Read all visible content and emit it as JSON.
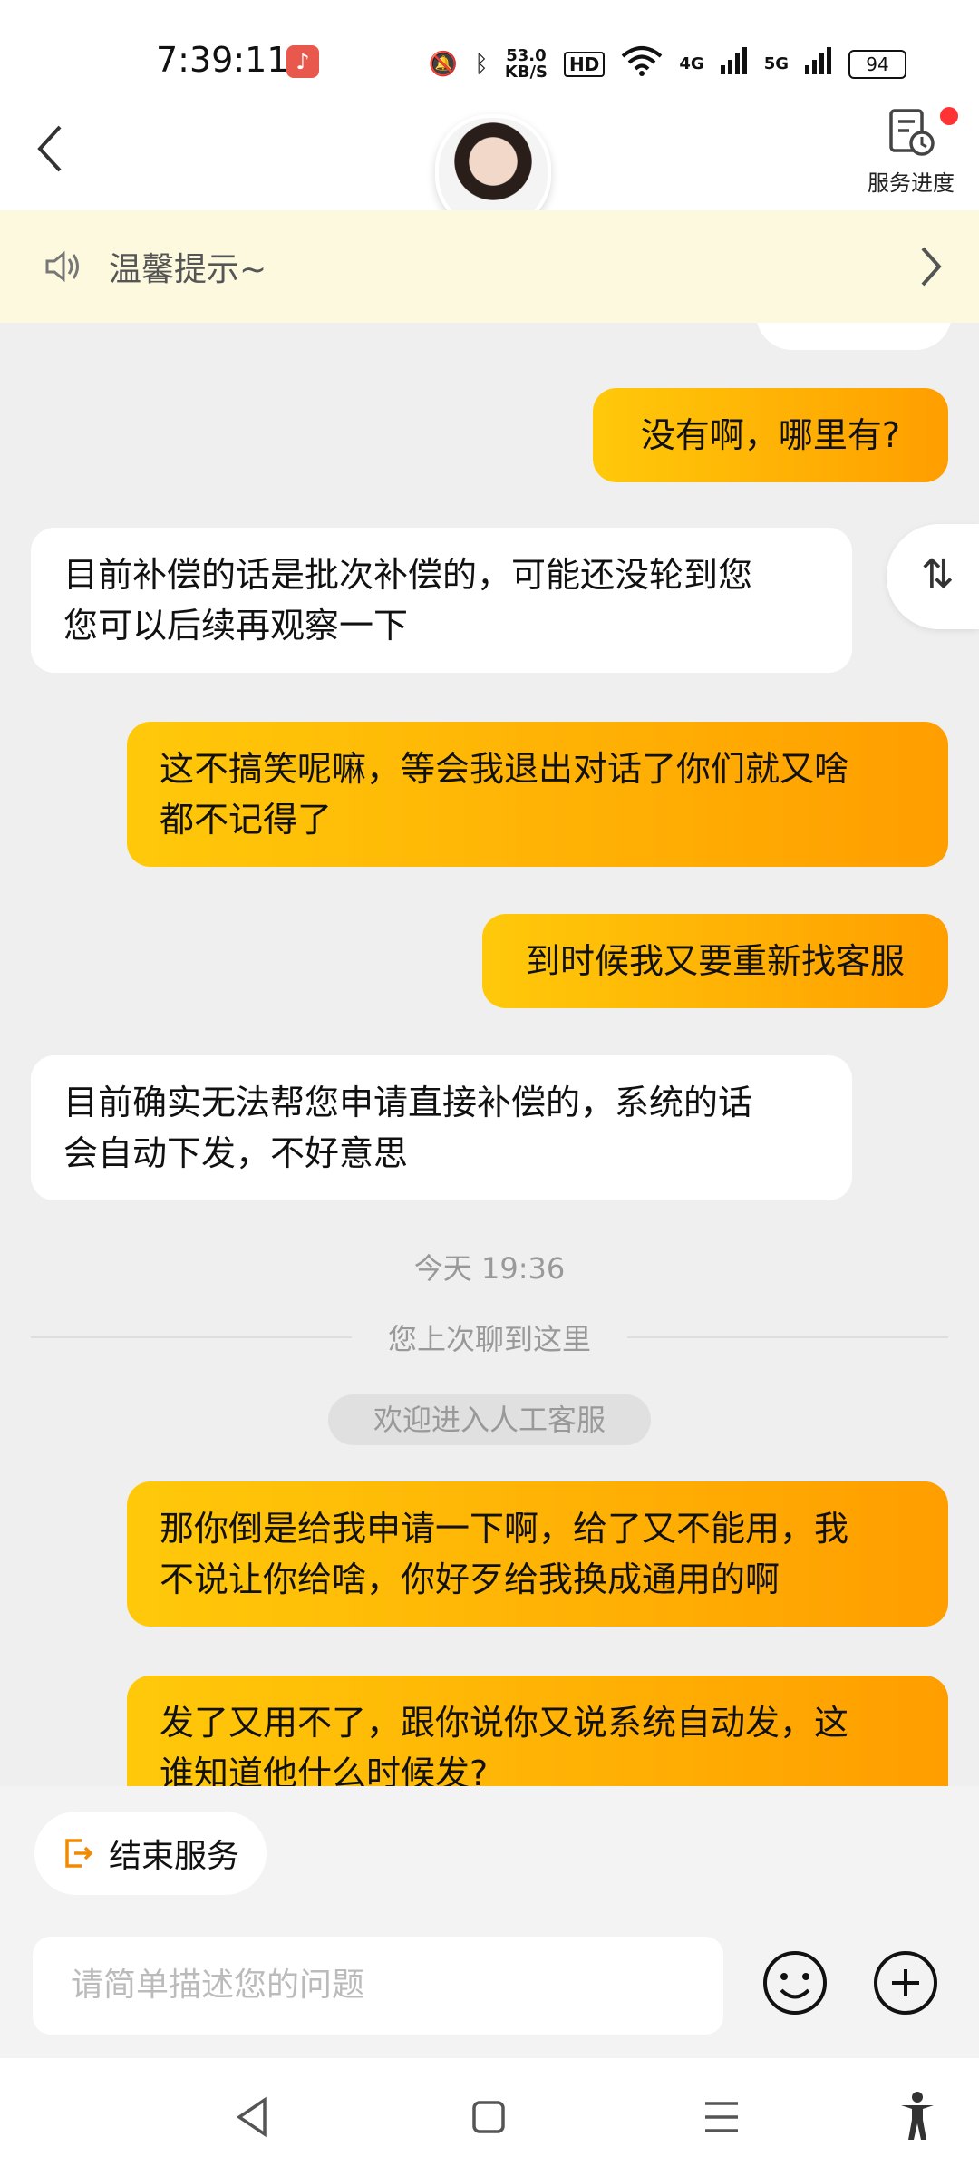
{
  "status_bar": {
    "time": "7:39:11",
    "net_speed": "53.0",
    "net_unit": "KB/S",
    "hd": "HD",
    "sig1": "4G",
    "sig2": "5G",
    "battery": "94"
  },
  "header": {
    "service_progress_label": "服务进度"
  },
  "tip_bar": {
    "text": "温馨提示~"
  },
  "toggle_label": "⇅",
  "messages": [
    {
      "side": "me",
      "text": "没有啊，哪里有?"
    },
    {
      "side": "them",
      "line1": "目前补偿的话是批次补偿的，可能还没轮到您",
      "line2": "您可以后续再观察一下"
    },
    {
      "side": "me",
      "line1": "这不搞笑呢嘛，等会我退出对话了你们就又啥",
      "line2": "都不记得了"
    },
    {
      "side": "me",
      "text": "到时候我又要重新找客服"
    },
    {
      "side": "them",
      "line1": "目前确实无法帮您申请直接补偿的，系统的话",
      "line2": "会自动下发，不好意思"
    },
    {
      "side": "me",
      "line1": "那你倒是给我申请一下啊，给了又不能用，我",
      "line2": "不说让你给啥，你好歹给我换成通用的啊"
    },
    {
      "side": "me",
      "line1": "发了又用不了，跟你说你又说系统自动发，这",
      "line2": "谁知道他什么时候发?"
    }
  ],
  "system": {
    "timestamp": "今天 19:36",
    "last_chat_divider": "您上次聊到这里",
    "welcome": "欢迎进入人工客服"
  },
  "bottom": {
    "end_service_label": "结束服务",
    "input_placeholder": "请简单描述您的问题"
  },
  "colors": {
    "accent_start": "#ffc90a",
    "accent_end": "#ff9e00",
    "tip_bg": "#fdf9de",
    "chat_bg": "#efefef"
  }
}
